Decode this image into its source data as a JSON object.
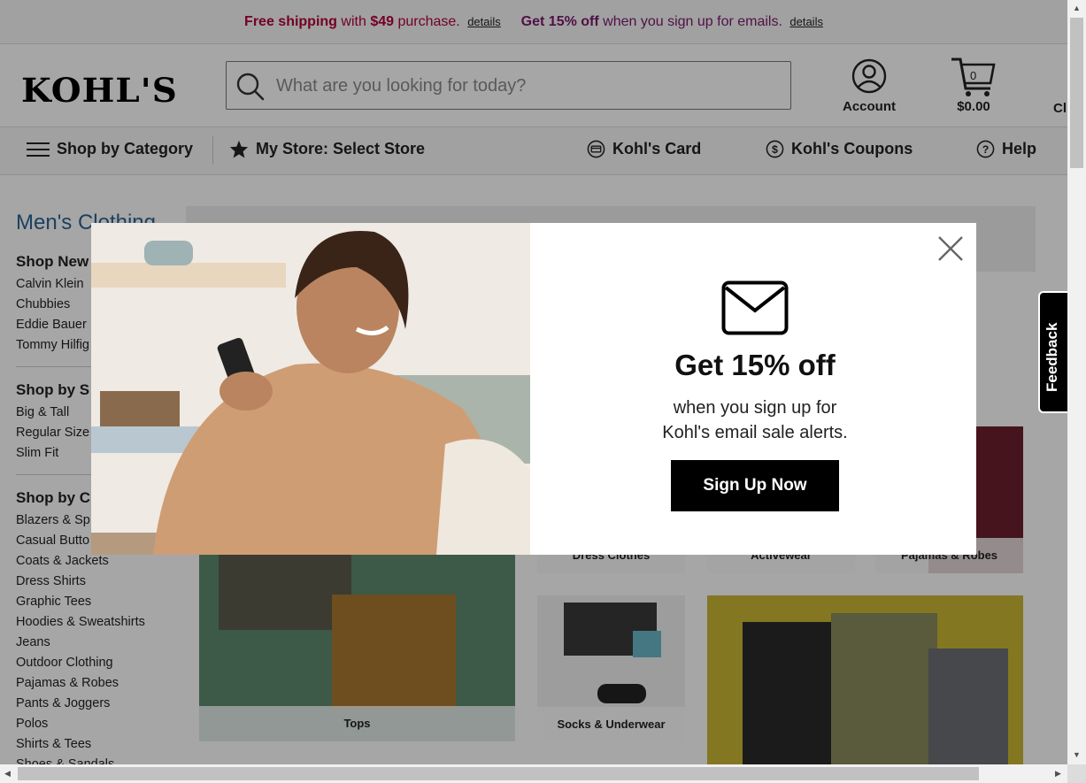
{
  "promo": {
    "free_shipping": "Free shipping",
    "with": "with",
    "amount": "$49",
    "purchase": "purchase.",
    "details1": "details",
    "get_off": "Get 15% off",
    "email_text": "when you sign up for emails.",
    "details2": "details"
  },
  "header": {
    "logo": "KOHL'S",
    "search_placeholder": "What are you looking for today?",
    "account_label": "Account",
    "cart_count": "0",
    "cart_total": "$0.00",
    "cutoff_label": "Cl"
  },
  "nav": {
    "shop_by_category": "Shop by Category",
    "my_store": "My Store: Select Store",
    "kohls_card": "Kohl's Card",
    "kohls_coupons": "Kohl's Coupons",
    "help": "Help"
  },
  "sidebar": {
    "title": "Men's Clothing",
    "sections": [
      {
        "heading": "Shop New",
        "links": [
          "Calvin Klein",
          "Chubbies",
          "Eddie Bauer",
          "Tommy Hilfig"
        ]
      },
      {
        "heading": "Shop by S",
        "links": [
          "Big & Tall",
          "Regular Size",
          "Slim Fit"
        ]
      },
      {
        "heading": "Shop by C",
        "links": [
          "Blazers & Sp",
          "Casual Butto",
          "Coats & Jackets",
          "Dress Shirts",
          "Graphic Tees",
          "Hoodies & Sweatshirts",
          "Jeans",
          "Outdoor Clothing",
          "Pajamas & Robes",
          "Pants & Joggers",
          "Polos",
          "Shirts & Tees",
          "Shoes & Sandals"
        ]
      }
    ]
  },
  "tiles": {
    "tops": "Tops",
    "dress_clothes": "Dress Clothes",
    "activewear": "Activewear",
    "pajamas_robes": "Pajamas & Robes",
    "socks_underwear": "Socks & Underwear"
  },
  "modal": {
    "title": "Get 15% off",
    "subtitle_line1": "when you sign up for",
    "subtitle_line2": "Kohl's email sale alerts.",
    "button": "Sign Up Now"
  },
  "feedback": {
    "label": "Feedback"
  },
  "colors": {
    "promo_red": "#b3003a",
    "promo_magenta": "#7c1a6e",
    "link_blue": "#2a6496",
    "button_black": "#000000"
  },
  "icons": [
    "search-icon",
    "account-icon",
    "cart-icon",
    "menu-icon",
    "star-icon",
    "card-icon",
    "coupon-icon",
    "help-icon",
    "close-icon",
    "mail-icon"
  ]
}
